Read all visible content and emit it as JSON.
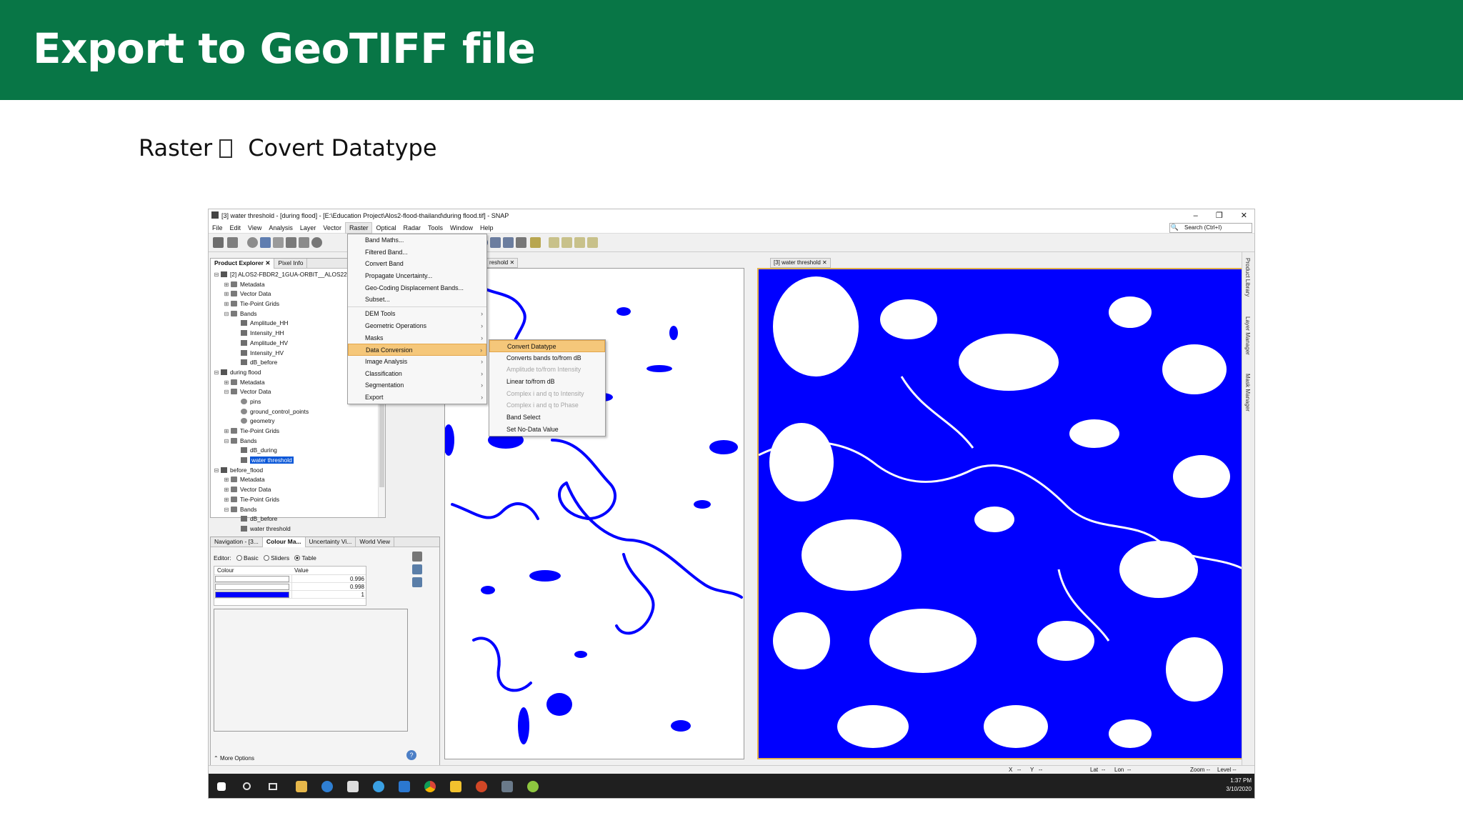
{
  "slide": {
    "title": "Export to GeoTIFF file",
    "subtitle_left": "Raster",
    "subtitle_right": "Covert Datatype",
    "colors": {
      "banner": "#087646",
      "water": "#0000ff"
    }
  },
  "window": {
    "title": "[3] water threshold - [during flood] - [E:\\Education Project\\Alos2-flood-thailand\\during flood.tif] - SNAP",
    "controls": [
      "–",
      "❐",
      "✕"
    ]
  },
  "menubar": [
    "File",
    "Edit",
    "View",
    "Analysis",
    "Layer",
    "Vector",
    "Raster",
    "Optical",
    "Radar",
    "Tools",
    "Window",
    "Help"
  ],
  "search_placeholder": "Search (Ctrl+I)",
  "explorer": {
    "tabs": [
      "Product Explorer",
      "Pixel Info"
    ],
    "tree": [
      {
        "label": "[2] ALOS2-FBDR2_1GUA-ORBIT__ALOS220",
        "level": 0,
        "icon": "product",
        "toggle": "-"
      },
      {
        "label": "Metadata",
        "level": 1,
        "icon": "folder",
        "toggle": "+"
      },
      {
        "label": "Vector Data",
        "level": 1,
        "icon": "folder",
        "toggle": "+"
      },
      {
        "label": "Tie-Point Grids",
        "level": 1,
        "icon": "folder",
        "toggle": "+"
      },
      {
        "label": "Bands",
        "level": 1,
        "icon": "folder",
        "toggle": "-"
      },
      {
        "label": "Amplitude_HH",
        "level": 2,
        "icon": "band"
      },
      {
        "label": "Intensity_HH",
        "level": 2,
        "icon": "band"
      },
      {
        "label": "Amplitude_HV",
        "level": 2,
        "icon": "band"
      },
      {
        "label": "Intensity_HV",
        "level": 2,
        "icon": "band"
      },
      {
        "label": "dB_before",
        "level": 2,
        "icon": "band"
      },
      {
        "label": "during flood",
        "level": 0,
        "icon": "product",
        "toggle": "-"
      },
      {
        "label": "Metadata",
        "level": 1,
        "icon": "folder",
        "toggle": "+"
      },
      {
        "label": "Vector Data",
        "level": 1,
        "icon": "folder",
        "toggle": "-"
      },
      {
        "label": "pins",
        "level": 2,
        "icon": "vector"
      },
      {
        "label": "ground_control_points",
        "level": 2,
        "icon": "vector"
      },
      {
        "label": "geometry",
        "level": 2,
        "icon": "vector"
      },
      {
        "label": "Tie-Point Grids",
        "level": 1,
        "icon": "folder",
        "toggle": "+"
      },
      {
        "label": "Bands",
        "level": 1,
        "icon": "folder",
        "toggle": "-"
      },
      {
        "label": "dB_during",
        "level": 2,
        "icon": "band"
      },
      {
        "label": "water threshold",
        "level": 2,
        "icon": "band",
        "selected": true
      },
      {
        "label": "before_flood",
        "level": 0,
        "icon": "product",
        "toggle": "-"
      },
      {
        "label": "Metadata",
        "level": 1,
        "icon": "folder",
        "toggle": "+"
      },
      {
        "label": "Vector Data",
        "level": 1,
        "icon": "folder",
        "toggle": "+"
      },
      {
        "label": "Tie-Point Grids",
        "level": 1,
        "icon": "folder",
        "toggle": "+"
      },
      {
        "label": "Bands",
        "level": 1,
        "icon": "folder",
        "toggle": "-"
      },
      {
        "label": "dB_before",
        "level": 2,
        "icon": "band"
      },
      {
        "label": "water threshold",
        "level": 2,
        "icon": "band"
      }
    ]
  },
  "lower_panel": {
    "tabs": [
      "Navigation - [3...",
      "Colour Ma...",
      "Uncertainty Vi...",
      "World View"
    ],
    "editor_label": "Editor:",
    "editor_options": [
      "Basic",
      "Sliders",
      "Table"
    ],
    "editor_selected": "Table",
    "table_headers": [
      "Colour",
      "Value"
    ],
    "table_rows": [
      {
        "colour": "#ffffff",
        "value": "0.996"
      },
      {
        "colour": "#ffffff",
        "value": "0.998"
      },
      {
        "colour": "#0000ff",
        "value": "1"
      }
    ],
    "more_options": "More Options"
  },
  "views": {
    "left_tab": "reshold",
    "right_tab": "[3] water threshold"
  },
  "raster_menu": {
    "items": [
      {
        "label": "Band Maths...",
        "submenu": false
      },
      {
        "label": "Filtered Band...",
        "submenu": false
      },
      {
        "label": "Convert Band",
        "submenu": false
      },
      {
        "label": "Propagate Uncertainty...",
        "submenu": false
      },
      {
        "label": "Geo-Coding Displacement Bands...",
        "submenu": false
      },
      {
        "label": "Subset...",
        "submenu": false
      },
      {
        "label": "DEM Tools",
        "submenu": true
      },
      {
        "label": "Geometric Operations",
        "submenu": true
      },
      {
        "label": "Masks",
        "submenu": true
      },
      {
        "label": "Data Conversion",
        "submenu": true,
        "highlighted": true
      },
      {
        "label": "Image Analysis",
        "submenu": true
      },
      {
        "label": "Classification",
        "submenu": true
      },
      {
        "label": "Segmentation",
        "submenu": true
      },
      {
        "label": "Export",
        "submenu": true
      }
    ]
  },
  "data_conversion_menu": {
    "items": [
      {
        "label": "Convert Datatype",
        "highlighted": true,
        "enabled": true
      },
      {
        "label": "Converts bands to/from dB",
        "enabled": true
      },
      {
        "label": "Amplitude to/from Intensity",
        "enabled": false
      },
      {
        "label": "Linear to/from dB",
        "enabled": true
      },
      {
        "label": "Complex i and q to Intensity",
        "enabled": false
      },
      {
        "label": "Complex i and q to Phase",
        "enabled": false
      },
      {
        "label": "Band Select",
        "enabled": true
      },
      {
        "label": "Set No-Data Value",
        "enabled": true
      }
    ]
  },
  "right_sidebar": [
    "Product Library",
    "Layer Manager",
    "Mask Manager"
  ],
  "statusbar": {
    "x": "X",
    "x_val": "--",
    "y": "Y",
    "y_val": "--",
    "lat": "Lat",
    "lat_val": "--",
    "lon": "Lon",
    "lon_val": "--",
    "zoom": "Zoom --",
    "level": "Level --"
  },
  "clock": {
    "time": "1:37 PM",
    "date": "3/10/2020"
  }
}
